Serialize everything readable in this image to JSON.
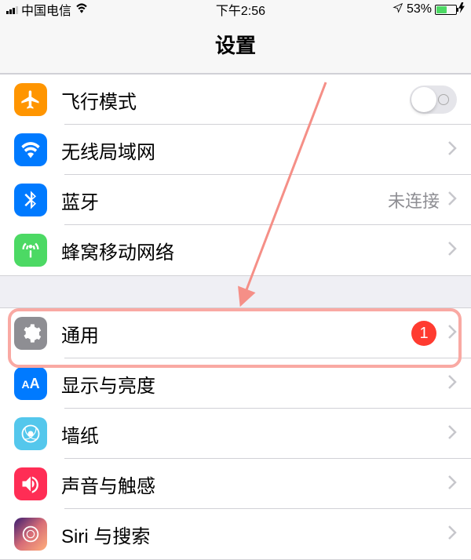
{
  "status": {
    "carrier": "中国电信",
    "time": "下午2:56",
    "battery_pct": "53%"
  },
  "header": {
    "title": "设置"
  },
  "section1": {
    "airplane": {
      "label": "飞行模式"
    },
    "wifi": {
      "label": "无线局域网"
    },
    "bluetooth": {
      "label": "蓝牙",
      "value": "未连接"
    },
    "cellular": {
      "label": "蜂窝移动网络"
    }
  },
  "section2": {
    "general": {
      "label": "通用",
      "badge": "1"
    },
    "display": {
      "label": "显示与亮度"
    },
    "wallpaper": {
      "label": "墙纸"
    },
    "sound": {
      "label": "声音与触感"
    },
    "siri": {
      "label": "Siri 与搜索"
    }
  }
}
